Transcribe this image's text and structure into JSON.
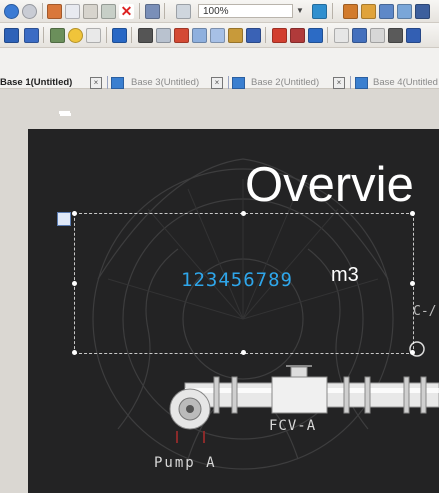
{
  "toolbar": {
    "zoom_value": "100%"
  },
  "tabs": [
    {
      "label": "Base 1(Untitled)",
      "active": true
    },
    {
      "label": "Base 3(Untitled)",
      "active": false
    },
    {
      "label": "Base 2(Untitled)",
      "active": false
    },
    {
      "label": "Base 4(Untitled",
      "active": false
    }
  ],
  "canvas": {
    "title": "Overvie",
    "numeric_display": "123456789",
    "unit": "m3",
    "valve_label": "FCV-A",
    "pump_label": "Pump A",
    "clipped_label": "C-/",
    "colors": {
      "background": "#232324",
      "numeric": "#2fa6ea",
      "text": "#ffffff"
    }
  }
}
